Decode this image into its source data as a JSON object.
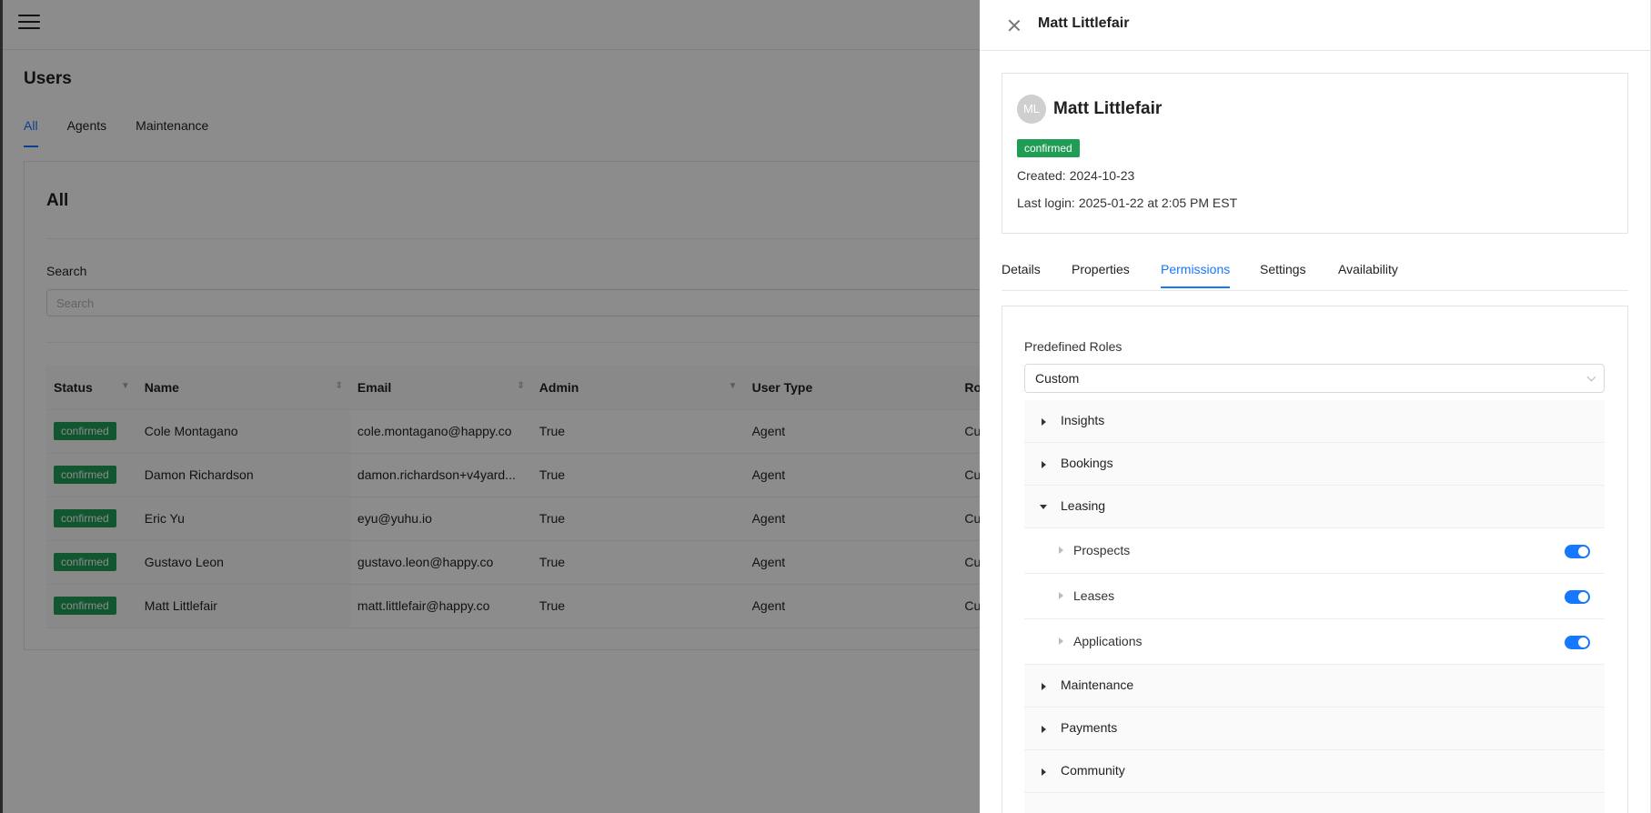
{
  "background": {
    "page_title": "Users",
    "tabs": [
      {
        "label": "All",
        "active": true
      },
      {
        "label": "Agents",
        "active": false
      },
      {
        "label": "Maintenance",
        "active": false
      }
    ],
    "card_title": "All",
    "search_label": "Search",
    "search_placeholder": "Search",
    "table": {
      "columns": [
        "Status",
        "Name",
        "Email",
        "Admin",
        "User Type",
        "Ro"
      ],
      "rows": [
        {
          "status": "confirmed",
          "name": "Cole Montagano",
          "email": "cole.montagano@happy.co",
          "admin": "True",
          "user_type": "Agent",
          "role": "Cu"
        },
        {
          "status": "confirmed",
          "name": "Damon Richardson",
          "email": "damon.richardson+v4yard...",
          "admin": "True",
          "user_type": "Agent",
          "role": "Cu"
        },
        {
          "status": "confirmed",
          "name": "Eric Yu",
          "email": "eyu@yuhu.io",
          "admin": "True",
          "user_type": "Agent",
          "role": "Cu"
        },
        {
          "status": "confirmed",
          "name": "Gustavo Leon",
          "email": "gustavo.leon@happy.co",
          "admin": "True",
          "user_type": "Agent",
          "role": "Cu"
        },
        {
          "status": "confirmed",
          "name": "Matt Littlefair",
          "email": "matt.littlefair@happy.co",
          "admin": "True",
          "user_type": "Agent",
          "role": "Cu"
        }
      ]
    }
  },
  "drawer": {
    "title": "Matt Littlefair",
    "user": {
      "initials": "ML",
      "name": "Matt Littlefair",
      "status": "confirmed",
      "created_label": "Created:",
      "created_value": "2024-10-23",
      "last_login_label": "Last login:",
      "last_login_value": "2025-01-22 at 2:05 PM EST"
    },
    "tabs": [
      {
        "label": "Details",
        "active": false
      },
      {
        "label": "Properties",
        "active": false
      },
      {
        "label": "Permissions",
        "active": true
      },
      {
        "label": "Settings",
        "active": false
      },
      {
        "label": "Availability",
        "active": false
      }
    ],
    "permissions": {
      "roles_label": "Predefined Roles",
      "roles_value": "Custom",
      "sections": [
        {
          "label": "Insights",
          "expanded": false
        },
        {
          "label": "Bookings",
          "expanded": false
        },
        {
          "label": "Leasing",
          "expanded": true,
          "children": [
            {
              "label": "Prospects",
              "enabled": true
            },
            {
              "label": "Leases",
              "enabled": true
            },
            {
              "label": "Applications",
              "enabled": true
            }
          ]
        },
        {
          "label": "Maintenance",
          "expanded": false
        },
        {
          "label": "Payments",
          "expanded": false
        },
        {
          "label": "Community",
          "expanded": false
        }
      ]
    }
  },
  "colors": {
    "accent": "#1677ff",
    "badge_green": "#1f9d55"
  }
}
